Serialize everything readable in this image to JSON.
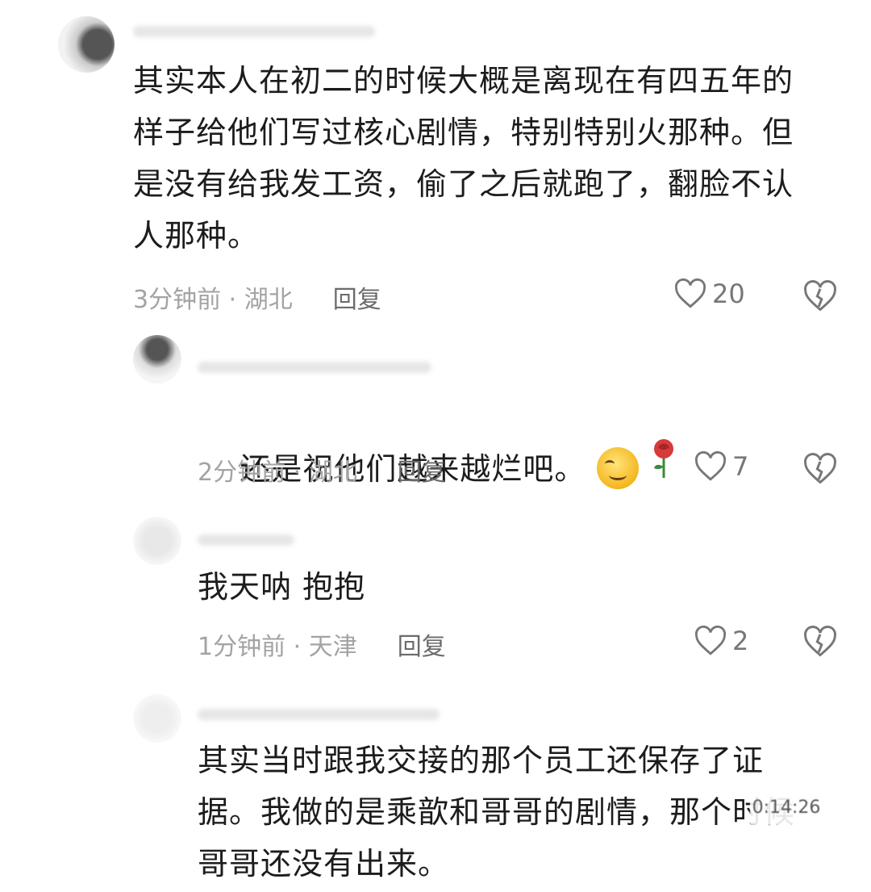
{
  "comments": [
    {
      "text": "其实本人在初二的时候大概是离现在有四五年的\n样子给他们写过核心剧情，特别特别火那种。但\n是没有给我发工资，偷了之后就跑了，翻脸不认\n人那种。",
      "time": "3分钟前 · 湖北",
      "reply_label": "回复",
      "likes": "20"
    },
    {
      "text": "还是祝他们越来越烂吧。",
      "time": "2分钟前 · 湖北",
      "reply_label": "回复",
      "likes": "7"
    },
    {
      "text": "我天呐 抱抱",
      "time": "1分钟前 · 天津",
      "reply_label": "回复",
      "likes": "2"
    },
    {
      "text": "其实当时跟我交接的那个员工还保存了证\n据。我做的是乘歆和哥哥的剧情，那个时候\n哥哥还没有出来。"
    }
  ],
  "watermark": "0:14:26",
  "icons": {
    "like": "heart-outline-icon",
    "dislike": "broken-heart-icon",
    "emoji_1": "wink-face-emoji",
    "emoji_2": "rose-emoji"
  },
  "colors": {
    "text": "#1c1c1c",
    "meta": "#a3a3a3",
    "reply": "#6b6b6b",
    "icon": "#777777"
  }
}
